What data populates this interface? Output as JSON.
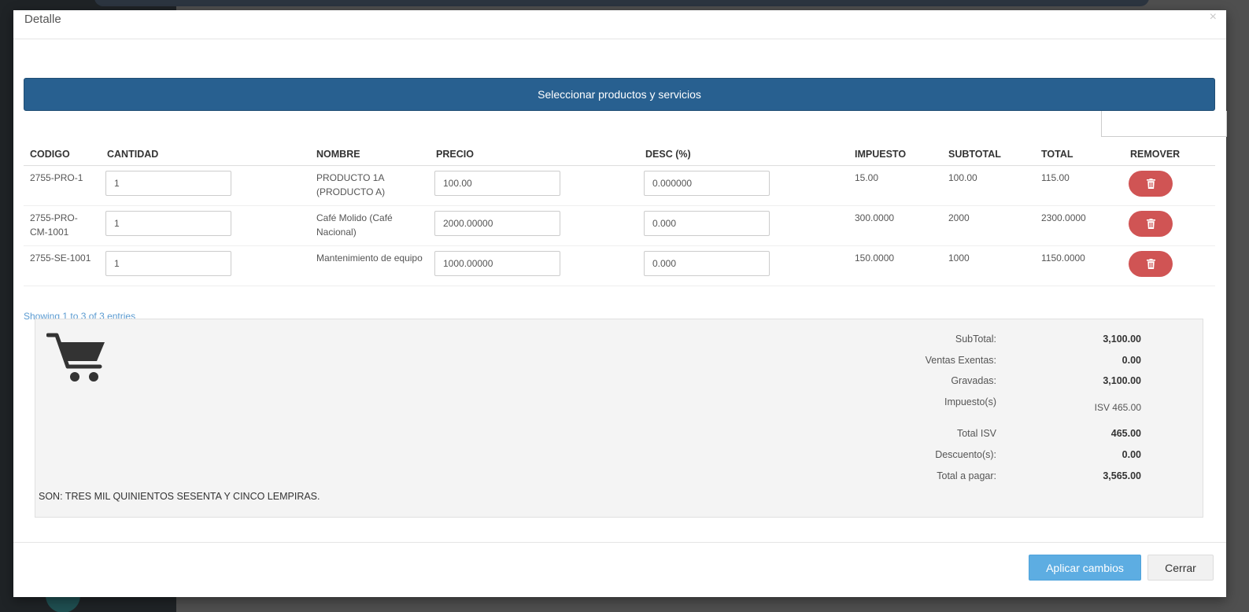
{
  "modal": {
    "title": "Detalle",
    "close_glyph": "×"
  },
  "select_button": {
    "label": "Seleccionar productos y servicios"
  },
  "table": {
    "headers": [
      "CODIGO",
      "CANTIDAD",
      "NOMBRE",
      "PRECIO",
      "DESC (%)",
      "IMPUESTO",
      "SUBTOTAL",
      "TOTAL",
      "REMOVER"
    ],
    "rows": [
      {
        "codigo": "2755-PRO-1",
        "cantidad": "1",
        "nombre": "PRODUCTO 1A (PRODUCTO A)",
        "precio": "100.00",
        "desc": "0.000000",
        "impuesto": "15.00",
        "subtotal": "100.00",
        "total": "115.00"
      },
      {
        "codigo": "2755-PRO-CM-1001",
        "cantidad": "1",
        "nombre": "Café Molido (Café Nacional)",
        "precio": "2000.00000",
        "desc": "0.000",
        "impuesto": "300.0000",
        "subtotal": "2000",
        "total": "2300.0000"
      },
      {
        "codigo": "2755-SE-1001",
        "cantidad": "1",
        "nombre": "Mantenimiento de equipo",
        "precio": "1000.00000",
        "desc": "0.000",
        "impuesto": "150.0000",
        "subtotal": "1000",
        "total": "1150.0000"
      }
    ],
    "info": "Showing 1 to 3 of 3 entries"
  },
  "summary": {
    "subtotal_label": "SubTotal:",
    "subtotal_value": "3,100.00",
    "exentas_label": "Ventas Exentas:",
    "exentas_value": "0.00",
    "gravadas_label": "Gravadas:",
    "gravadas_value": "3,100.00",
    "impuestos_label": "Impuesto(s)",
    "impuestos_value": "ISV 465.00",
    "total_isv_label": "Total ISV",
    "total_isv_value": "465.00",
    "descuentos_label": "Descuento(s):",
    "descuentos_value": "0.00",
    "total_pagar_label": "Total a pagar:",
    "total_pagar_value": "3,565.00",
    "son_text": "SON: TRES MIL QUINIENTOS SESENTA Y CINCO LEMPIRAS."
  },
  "footer": {
    "apply_label": "Aplicar cambios",
    "close_label": "Cerrar"
  },
  "icons": {
    "cart": "shopping-cart-icon",
    "trash": "trash-icon",
    "close": "close-icon"
  },
  "colors": {
    "primary": "#286090",
    "danger": "#d05454",
    "info": "#5dade2",
    "link": "#5b9bd1"
  }
}
